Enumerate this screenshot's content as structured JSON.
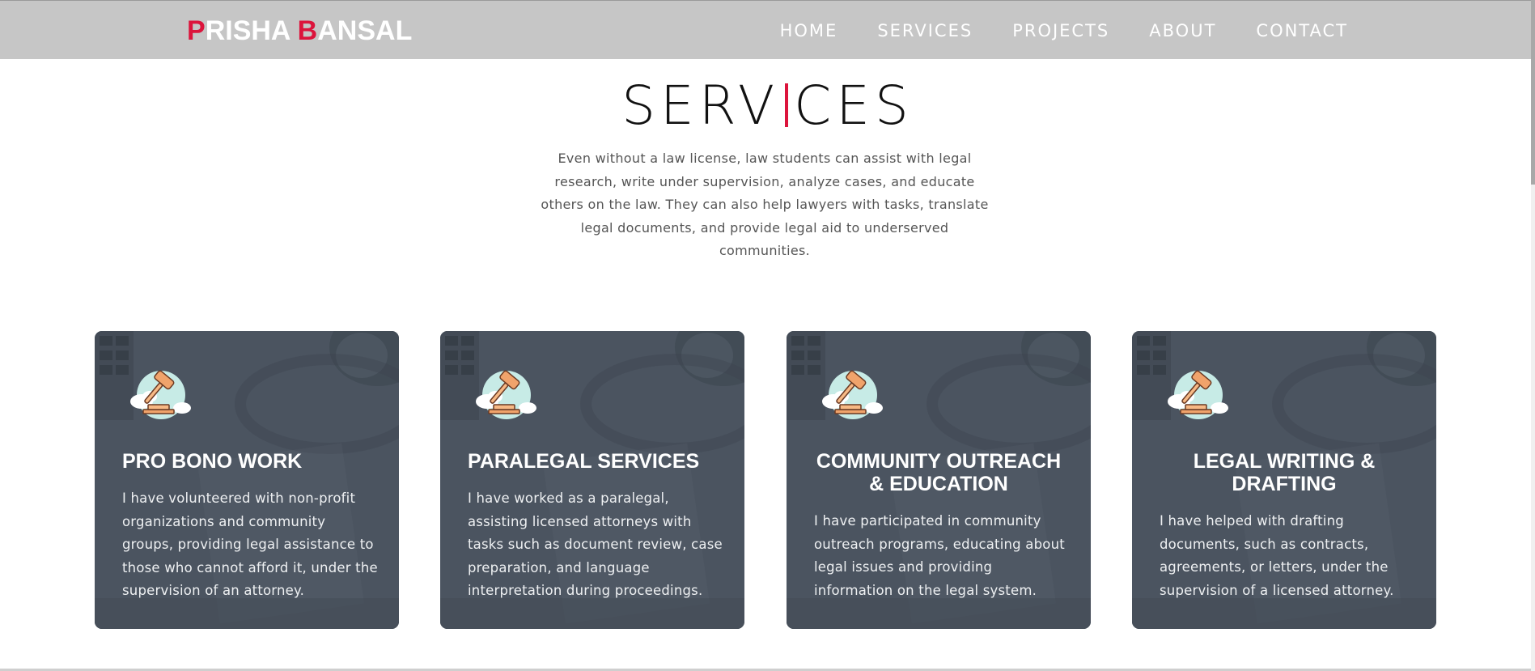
{
  "brand": {
    "first_initial": "P",
    "first_rest": "RISHA ",
    "last_initial": "B",
    "last_rest": "ANSAL",
    "accent_color": "#dc143c"
  },
  "nav": {
    "items": [
      {
        "label": "HOME"
      },
      {
        "label": "SERVICES"
      },
      {
        "label": "PROJECTS"
      },
      {
        "label": "ABOUT"
      },
      {
        "label": "CONTACT"
      }
    ]
  },
  "section": {
    "title_before": "SERV",
    "title_after": "CES",
    "intro": "Even without a law license, law students can assist with legal research, write under supervision, analyze cases, and educate others on the law. They can also help lawyers with tasks, translate legal documents, and provide legal aid to underserved communities."
  },
  "cards": [
    {
      "icon": "gavel-icon",
      "title": "PRO BONO WORK",
      "text": "I have volunteered with non-profit organizations and community groups, providing legal assistance to those who cannot afford it, under the supervision of an attorney."
    },
    {
      "icon": "gavel-icon",
      "title": "PARALEGAL SERVICES",
      "text": "I have worked as a paralegal, assisting licensed attorneys with tasks such as document review, case preparation, and language interpretation during proceedings."
    },
    {
      "icon": "gavel-icon",
      "title": "COMMUNITY OUTREACH & EDUCATION",
      "text": "I have participated in community outreach programs, educating about legal issues and providing information on the legal system."
    },
    {
      "icon": "gavel-icon",
      "title": "LEGAL WRITING & DRAFTING",
      "text": "I have helped with drafting documents, such as contracts, agreements, or letters, under the supervision of a licensed attorney."
    }
  ],
  "colors": {
    "navbar_bg": "#c6c6c6",
    "card_bg": "#4a535f",
    "accent": "#dc143c"
  }
}
